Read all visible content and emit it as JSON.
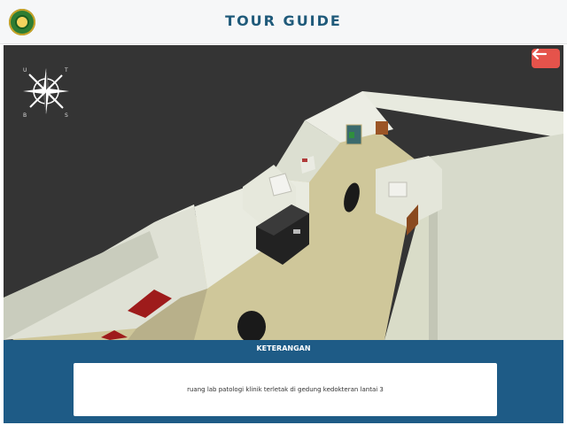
{
  "header": {
    "title": "TOUR GUIDE",
    "logo_icon": "university-seal-icon"
  },
  "viewer": {
    "back_icon": "arrow-left-icon",
    "compass": {
      "icon": "compass-rose-icon",
      "north": "U",
      "east": "T",
      "south": "S",
      "west": "B"
    }
  },
  "info": {
    "heading": "KETERANGAN",
    "text": "ruang lab patologi klinik terletak di gedung kedokteran lantai 3"
  },
  "colors": {
    "header_title": "#1f5a7a",
    "info_panel": "#1e5b86",
    "back_button": "#e5534b",
    "viewport_bg": "#343434"
  }
}
